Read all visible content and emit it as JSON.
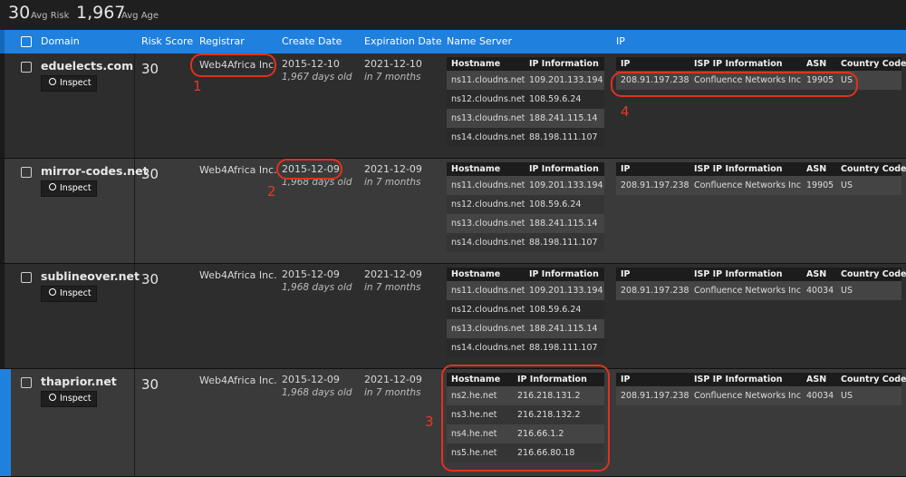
{
  "summary": {
    "risk_value": "30",
    "risk_label": "Avg Risk",
    "age_value": "1,967",
    "age_label": "Avg Age"
  },
  "columns": {
    "domain": "Domain",
    "risk": "Risk Score",
    "registrar": "Registrar",
    "create": "Create Date",
    "expiration": "Expiration Date",
    "nameserver": "Name Server",
    "ip": "IP"
  },
  "inspect_label": "Inspect",
  "ns_headers": [
    "Hostname",
    "IP Information"
  ],
  "ip_headers": [
    "IP",
    "ISP IP Information",
    "ASN",
    "Country Code"
  ],
  "rows": [
    {
      "domain": "eduelects.com",
      "risk": "30",
      "registrar": "Web4Africa Inc.",
      "create": "2015-12-10",
      "create_age": "1,967 days old",
      "expire": "2021-12-10",
      "expire_in": "in 7 months",
      "ns": [
        [
          "ns11.cloudns.net",
          "109.201.133.194"
        ],
        [
          "ns12.cloudns.net",
          "108.59.6.24"
        ],
        [
          "ns13.cloudns.net",
          "188.241.115.14"
        ],
        [
          "ns14.cloudns.net",
          "88.198.111.107"
        ]
      ],
      "ip": [
        "208.91.197.238",
        "Confluence Networks Inc",
        "19905",
        "US"
      ]
    },
    {
      "domain": "mirror-codes.net",
      "risk": "30",
      "registrar": "Web4Africa Inc.",
      "create": "2015-12-09",
      "create_age": "1,968 days old",
      "expire": "2021-12-09",
      "expire_in": "in 7 months",
      "ns": [
        [
          "ns11.cloudns.net",
          "109.201.133.194"
        ],
        [
          "ns12.cloudns.net",
          "108.59.6.24"
        ],
        [
          "ns13.cloudns.net",
          "188.241.115.14"
        ],
        [
          "ns14.cloudns.net",
          "88.198.111.107"
        ]
      ],
      "ip": [
        "208.91.197.238",
        "Confluence Networks Inc",
        "19905",
        "US"
      ]
    },
    {
      "domain": "sublineover.net",
      "risk": "30",
      "registrar": "Web4Africa Inc.",
      "create": "2015-12-09",
      "create_age": "1,968 days old",
      "expire": "2021-12-09",
      "expire_in": "in 7 months",
      "ns": [
        [
          "ns11.cloudns.net",
          "109.201.133.194"
        ],
        [
          "ns12.cloudns.net",
          "108.59.6.24"
        ],
        [
          "ns13.cloudns.net",
          "188.241.115.14"
        ],
        [
          "ns14.cloudns.net",
          "88.198.111.107"
        ]
      ],
      "ip": [
        "208.91.197.238",
        "Confluence Networks Inc",
        "40034",
        "US"
      ]
    },
    {
      "domain": "thaprior.net",
      "risk": "30",
      "registrar": "Web4Africa Inc.",
      "create": "2015-12-09",
      "create_age": "1,968 days old",
      "expire": "2021-12-09",
      "expire_in": "in 7 months",
      "ns": [
        [
          "ns2.he.net",
          "216.218.131.2"
        ],
        [
          "ns3.he.net",
          "216.218.132.2"
        ],
        [
          "ns4.he.net",
          "216.66.1.2"
        ],
        [
          "ns5.he.net",
          "216.66.80.18"
        ]
      ],
      "ip": [
        "208.91.197.238",
        "Confluence Networks Inc",
        "40034",
        "US"
      ]
    }
  ],
  "annotations": [
    "1",
    "2",
    "3",
    "4"
  ],
  "colors": {
    "accent": "#1f80de",
    "annotation": "#e0321f"
  }
}
